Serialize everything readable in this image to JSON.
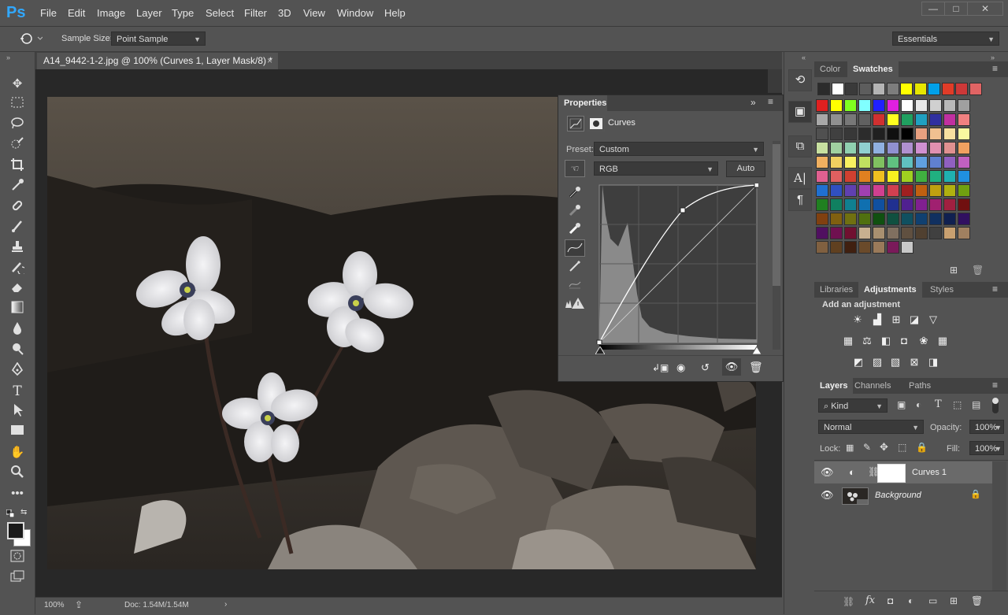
{
  "app": {
    "logo": "Ps"
  },
  "menu": [
    "File",
    "Edit",
    "Image",
    "Layer",
    "Type",
    "Select",
    "Filter",
    "3D",
    "View",
    "Window",
    "Help"
  ],
  "window_controls": {
    "minimize": "—",
    "maximize": "□",
    "close": "✕"
  },
  "options_bar": {
    "sample_size_label": "Sample Size:",
    "sample_size_value": "Point Sample",
    "workspace": "Essentials"
  },
  "document": {
    "tab_title": "A14_9442-1-2.jpg @ 100% (Curves 1, Layer Mask/8) *",
    "close": "×"
  },
  "status": {
    "zoom": "100%",
    "doc": "Doc: 1.54M/1.54M",
    "arrow": "›"
  },
  "properties": {
    "tab": "Properties",
    "section": "Curves",
    "preset_label": "Preset:",
    "preset_value": "Custom",
    "channel": "RGB",
    "auto_button": "Auto"
  },
  "color_panel": {
    "tabs": [
      "Color",
      "Swatches"
    ]
  },
  "swatches": {
    "top_row": [
      "#2b2b2b",
      "#ffffff",
      "#3a3a3a",
      "#5d5d5d",
      "#b4b4b4",
      "#7d7d7d",
      "#ffff00",
      "#e6e600",
      "#00a0e9",
      "#e03c28",
      "#cc3838",
      "#e06464"
    ],
    "grid": [
      "#e02020",
      "#ffff00",
      "#80ff20",
      "#80ffff",
      "#2020ff",
      "#e020e0",
      "#ffffff",
      "#e8e8e8",
      "#d0d0d0",
      "#b8b8b8",
      "#a0a0a0",
      "#a8a8a8",
      "#909090",
      "#787878",
      "#606060",
      "#d03030",
      "#ffff20",
      "#20a060",
      "#20a0c0",
      "#3030a0",
      "#c030a0",
      "#f08080",
      "#505050",
      "#404040",
      "#383838",
      "#2c2c2c",
      "#202020",
      "#101010",
      "#000000",
      "#e8a080",
      "#f0c090",
      "#f8e0a0",
      "#f8f8a0",
      "#c8e0a0",
      "#a0d0a0",
      "#90d0b0",
      "#90d0d0",
      "#90b0e0",
      "#9090d0",
      "#b090d0",
      "#d090d0",
      "#e090b0",
      "#e09090",
      "#f0a060",
      "#f0b060",
      "#f0d060",
      "#f8f060",
      "#c0e060",
      "#80c060",
      "#60c080",
      "#60c0c0",
      "#60a0e0",
      "#6080d0",
      "#9060c0",
      "#c060c0",
      "#e06090",
      "#e06060",
      "#d04030",
      "#e08020",
      "#f0c020",
      "#f8f020",
      "#a0d020",
      "#40b040",
      "#20b080",
      "#20b0b0",
      "#2090e0",
      "#2070d0",
      "#3050c0",
      "#6040b0",
      "#a040b0",
      "#d04090",
      "#d04050",
      "#a02020",
      "#c06010",
      "#c0a010",
      "#b0b010",
      "#70a010",
      "#208020",
      "#108060",
      "#108090",
      "#1070b0",
      "#1050a0",
      "#203090",
      "#502090",
      "#802090",
      "#a02070",
      "#a02040",
      "#701010",
      "#804010",
      "#806010",
      "#707010",
      "#507010",
      "#105010",
      "#105040",
      "#105060",
      "#104070",
      "#103060",
      "#102050",
      "#301060",
      "#501060",
      "#701050",
      "#701030",
      "#c8b090",
      "#a89070",
      "#807060",
      "#605040",
      "#504030",
      "#404040",
      "#c8a070",
      "#a08060",
      "#806040",
      "#604020",
      "#402010",
      "#6a4a2a",
      "#9a7a5a",
      "#7a1a5a",
      "#c8c8c8"
    ]
  },
  "mid_panel": {
    "tabs": [
      "Libraries",
      "Adjustments",
      "Styles"
    ],
    "heading": "Add an adjustment"
  },
  "adjustment_icons": [
    [
      "brightness-icon",
      "levels-icon",
      "curves-icon",
      "exposure-icon",
      "vibrance-icon"
    ],
    [
      "hue-saturation-icon",
      "color-balance-icon",
      "black-white-icon",
      "photo-filter-icon",
      "channel-mixer-icon",
      "color-lookup-icon"
    ],
    [
      "invert-icon",
      "posterize-icon",
      "threshold-icon",
      "selective-color-icon",
      "gradient-map-icon"
    ]
  ],
  "layers_panel": {
    "tabs": [
      "Layers",
      "Channels",
      "Paths"
    ],
    "filter_kind": "Kind",
    "blend_mode": "Normal",
    "opacity_label": "Opacity:",
    "opacity_value": "100%",
    "lock_label": "Lock:",
    "fill_label": "Fill:",
    "fill_value": "100%",
    "layers": [
      {
        "name": "Curves 1",
        "selected": true
      },
      {
        "name": "Background",
        "selected": false
      }
    ]
  },
  "colors": {
    "bg": "#535353",
    "panel_dark": "#424242",
    "canvas": "#282828",
    "accent": "#31a8ff"
  }
}
